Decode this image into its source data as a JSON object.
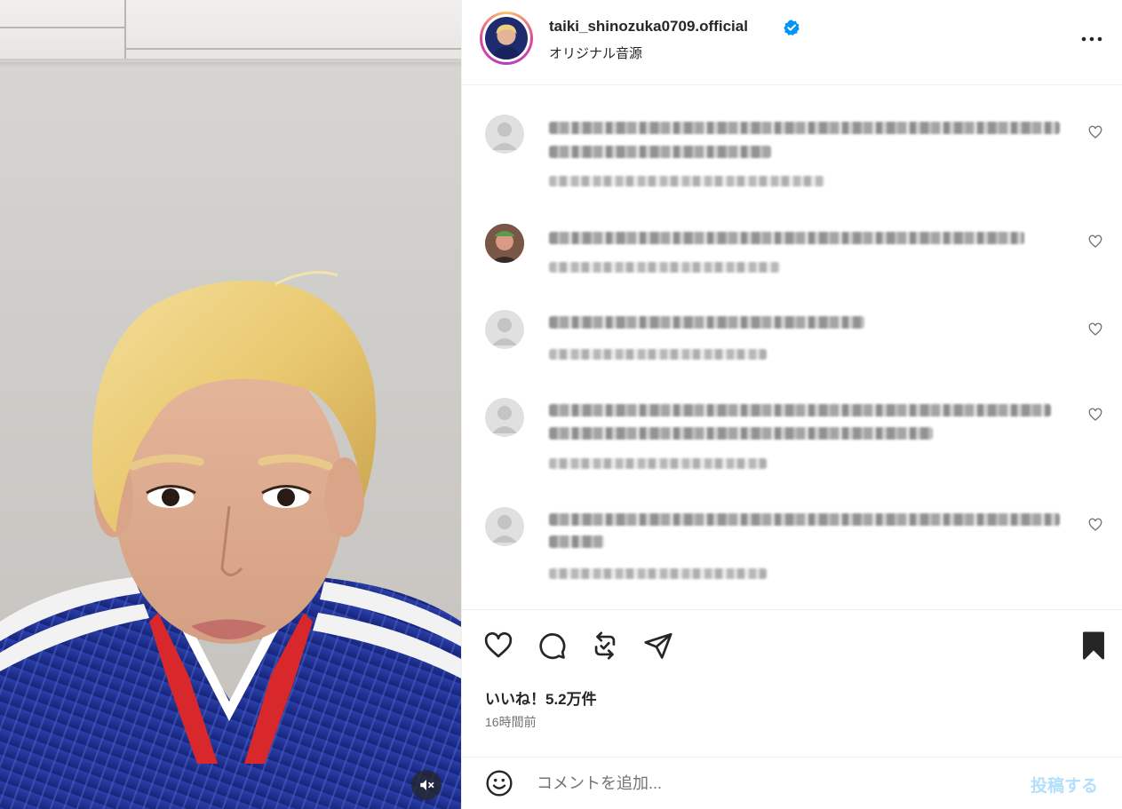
{
  "post": {
    "username": "taiki_shinozuka0709.official",
    "audio_label": "オリジナル音源",
    "likes_text": "いいね！5.2万件",
    "time_text": "16時間前"
  },
  "comment_box": {
    "placeholder": "コメントを追加...",
    "post_label": "投稿する"
  },
  "colors": {
    "verified_blue": "#0095f6",
    "post_button_disabled": "#b2dffc",
    "text_primary": "#262626",
    "text_secondary": "#737373",
    "jersey_blue": "#1c2f8f"
  },
  "icons": {
    "header": [
      "verified-icon",
      "more-icon"
    ],
    "actions": [
      "heart-icon",
      "comment-icon",
      "repost-icon",
      "share-icon",
      "bookmark-icon"
    ],
    "media": [
      "mute-icon"
    ],
    "comment_bar": [
      "emoji-icon"
    ]
  }
}
